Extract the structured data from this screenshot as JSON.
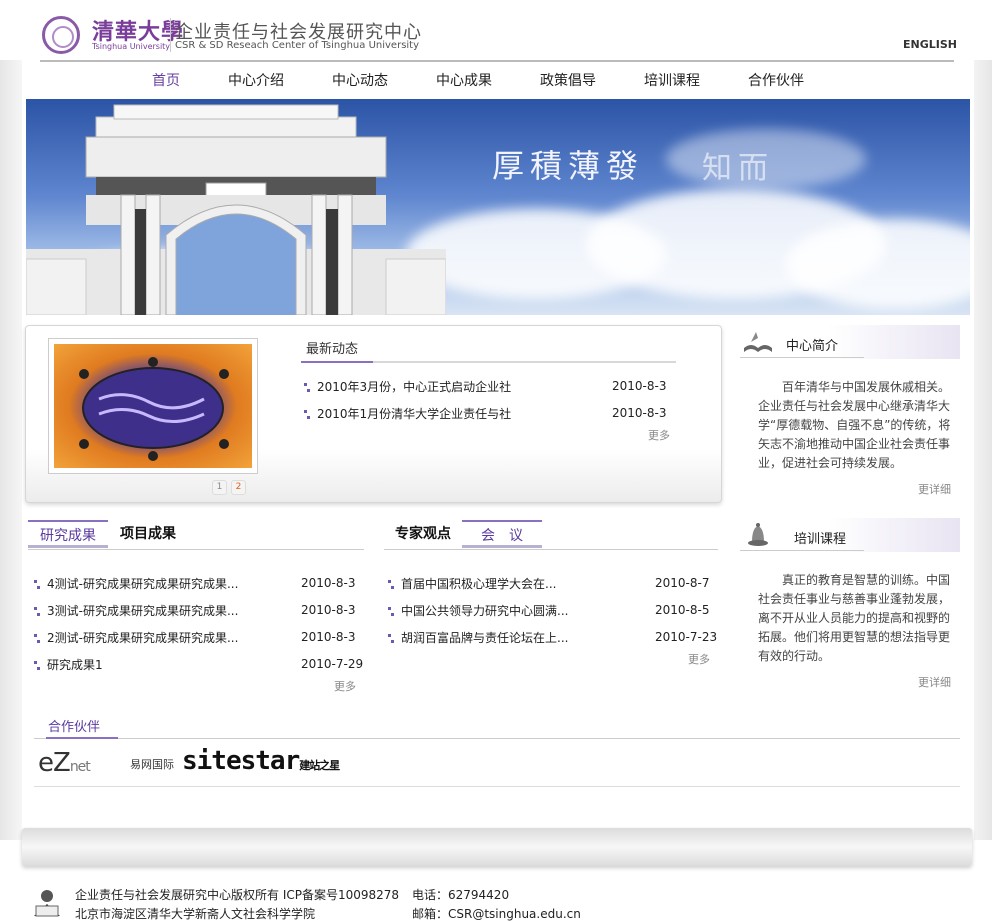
{
  "header": {
    "logo_cn": "清華大學",
    "logo_en": "Tsinghua University",
    "center_cn": "企业责任与社会发展研究中心",
    "center_en": "CSR & SD Reseach Center of Tsinghua University",
    "english_link": "ENGLISH"
  },
  "nav": [
    "首页",
    "中心介绍",
    "中心动态",
    "中心成果",
    "政策倡导",
    "培训课程",
    "合作伙伴"
  ],
  "banner": {
    "text": "厚積薄發",
    "text2": "知而"
  },
  "news": {
    "title": "最新动态",
    "items": [
      {
        "title": "2010年3月份，中心正式启动企业社",
        "date": "2010-8-3"
      },
      {
        "title": "2010年1月份清华大学企业责任与社",
        "date": "2010-8-3"
      }
    ],
    "more": "更多",
    "pages": [
      "1",
      "2"
    ]
  },
  "intro": {
    "title": "中心简介",
    "text": "百年清华与中国发展休戚相关。企业责任与社会发展中心继承清华大学“厚德载物、自强不息”的传统，将矢志不渝地推动中国企业社会责任事业，促进社会可持续发展。",
    "more": "更详细"
  },
  "training": {
    "title": "培训课程",
    "text": "真正的教育是智慧的训练。中国社会责任事业与慈善事业蓬勃发展，离不开从业人员能力的提高和视野的拓展。他们将用更智慧的想法指导更有效的行动。",
    "more": "更详细"
  },
  "research": {
    "tabs": [
      "研究成果",
      "项目成果"
    ],
    "items": [
      {
        "title": "4测试-研究成果研究成果研究成果...",
        "date": "2010-8-3"
      },
      {
        "title": "3测试-研究成果研究成果研究成果...",
        "date": "2010-8-3"
      },
      {
        "title": "2测试-研究成果研究成果研究成果...",
        "date": "2010-8-3"
      },
      {
        "title": "研究成果1",
        "date": "2010-7-29"
      }
    ],
    "more": "更多"
  },
  "opinion": {
    "tabs": [
      "专家观点",
      "会　议"
    ],
    "items": [
      {
        "title": "首届中国积极心理学大会在...",
        "date": "2010-8-7"
      },
      {
        "title": "中国公共领导力研究中心圆满...",
        "date": "2010-8-5"
      },
      {
        "title": "胡润百富品牌与责任论坛在上...",
        "date": "2010-7-23"
      }
    ],
    "more": "更多"
  },
  "partners": {
    "title": "合作伙伴",
    "ez": "eZ",
    "ez_sub": "net",
    "yiwang": "易网国际",
    "sitestar": "sitestar",
    "sitestar_sub": "建站之星"
  },
  "footer": {
    "copyright": "企业责任与社会发展研究中心版权所有 ICP备案号10098278",
    "address": "北京市海淀区清华大学新斋人文社会科学学院",
    "phone": "电话：62794420",
    "email": "邮箱：CSR@tsinghua.edu.cn"
  }
}
